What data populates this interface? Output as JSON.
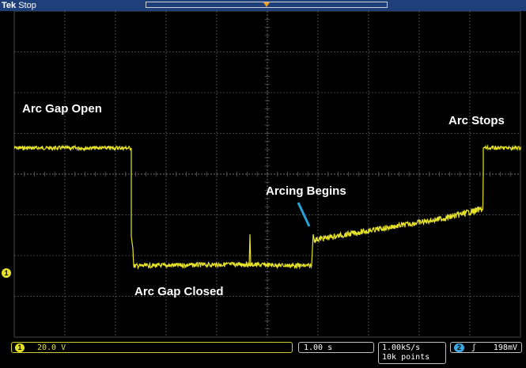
{
  "header": {
    "brand": "Tek",
    "acquisition_state": "Stop"
  },
  "channel_marker": "1",
  "annotations": {
    "arc_gap_open": "Arc Gap Open",
    "arc_gap_closed": "Arc Gap Closed",
    "arcing_begins": "Arcing Begins",
    "arc_stops": "Arc Stops"
  },
  "colors": {
    "trace": "#e6e22a",
    "grid": "#5a5a5a",
    "pointer": "#2aa0d8",
    "header_bar": "#1f3f7a"
  },
  "readouts": {
    "ch1_number": "1",
    "ch1_scale": "20.0 V",
    "timebase": "1.00 s",
    "sample_rate": "1.00kS/s",
    "record_length": "10k points",
    "trigger_source": "2",
    "trigger_slope": "ʃ",
    "trigger_level": "198mV"
  }
}
